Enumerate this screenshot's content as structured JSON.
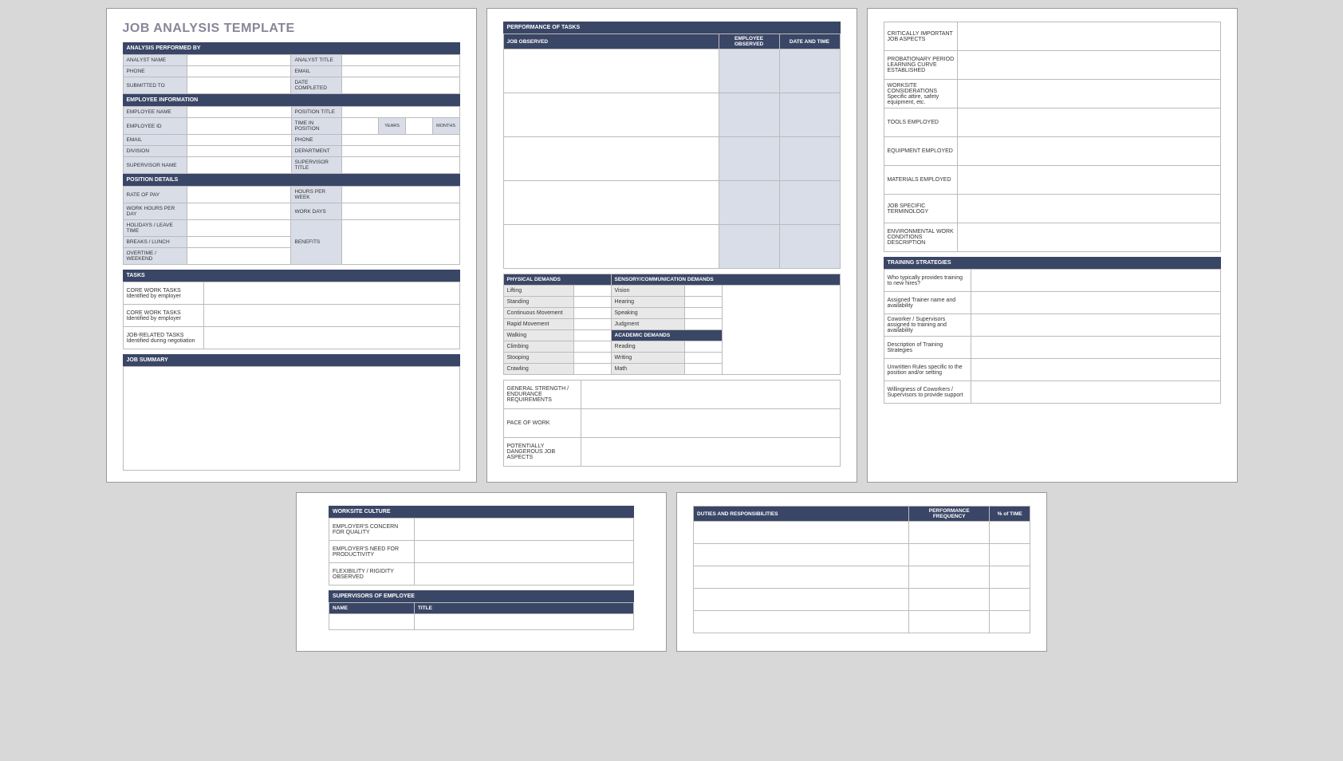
{
  "page1": {
    "title": "JOB ANALYSIS TEMPLATE",
    "sec1": {
      "hdr": "ANALYSIS PERFORMED BY",
      "r1a": "ANALYST NAME",
      "r1b": "ANALYST TITLE",
      "r2a": "PHONE",
      "r2b": "EMAIL",
      "r3a": "SUBMITTED TO",
      "r3b": "DATE COMPLETED"
    },
    "sec2": {
      "hdr": "EMPLOYEE INFORMATION",
      "r1a": "EMPLOYEE NAME",
      "r1b": "POSITION TITLE",
      "r2a": "EMPLOYEE ID",
      "r2b": "TIME IN POSITION",
      "r2c": "YEARS",
      "r2d": "MONTHS",
      "r3a": "EMAIL",
      "r3b": "PHONE",
      "r4a": "DIVISION",
      "r4b": "DEPARTMENT",
      "r5a": "SUPERVISOR NAME",
      "r5b": "SUPERVISOR TITLE"
    },
    "sec3": {
      "hdr": "POSITION DETAILS",
      "r1a": "RATE OF PAY",
      "r1b": "HOURS PER WEEK",
      "r2a": "WORK HOURS PER DAY",
      "r2b": "WORK DAYS",
      "r3a": "HOLIDAYS / LEAVE TIME",
      "r4a": "BREAKS / LUNCH",
      "rb": "BENEFITS",
      "r5a": "OVERTIME / WEEKEND"
    },
    "sec4": {
      "hdr": "TASKS",
      "r1": "CORE WORK TASKS\nIdentified by employer",
      "r2": "CORE WORK TASKS\nIdentified by employer",
      "r3": "JOB-RELATED TASKS\nIdentified during negotiation"
    },
    "sec5": {
      "hdr": "JOB SUMMARY"
    }
  },
  "page2": {
    "sec1": {
      "hdr": "PERFORMANCE OF TASKS",
      "c1": "JOB OBSERVED",
      "c2": "EMPLOYEE OBSERVED",
      "c3": "DATE AND TIME"
    },
    "sec2": {
      "h1": "PHYSICAL DEMANDS",
      "h2": "SENSORY/COMMUNICATION DEMANDS",
      "p1": "Lifting",
      "p2": "Standing",
      "p3": "Continuous Movement",
      "p4": "Rapid Movement",
      "p5": "Walking",
      "p6": "Climbing",
      "p7": "Stooping",
      "p8": "Crawling",
      "s1": "Vision",
      "s2": "Hearing",
      "s3": "Speaking",
      "s4": "Judgment",
      "ah": "ACADEMIC DEMANDS",
      "a1": "Reading",
      "a2": "Writing",
      "a3": "Math"
    },
    "sec3": {
      "r1": "GENERAL STRENGTH / ENDURANCE REQUIREMENTS",
      "r2": "PACE OF WORK",
      "r3": "POTENTIALLY DANGEROUS JOB ASPECTS"
    }
  },
  "page3": {
    "rows": {
      "r1": "CRITICALLY IMPORTANT JOB ASPECTS",
      "r2": "PROBATIONARY PERIOD LEARNING CURVE ESTABLISHED",
      "r3": "WORKSITE CONSIDERATIONS\nSpecific attire, safety equipment, etc.",
      "r4": "TOOLS EMPLOYED",
      "r5": "EQUIPMENT EMPLOYED",
      "r6": "MATERIALS EMPLOYED",
      "r7": "JOB SPECIFIC TERMINOLOGY",
      "r8": "ENVIRONMENTAL WORK CONDITIONS DESCRIPTION"
    },
    "sec2": {
      "hdr": "TRAINING STRATEGIES",
      "r1": "Who typically provides training to new hires?",
      "r2": "Assigned Trainer name and availability",
      "r3": "Coworker / Supervisors assigned to training and availability",
      "r4": "Description of Training Strategies",
      "r5": "Unwritten Rules specific to the position and/or setting",
      "r6": "Willingness of Coworkers / Supervisors to provide support"
    }
  },
  "page4": {
    "sec1": {
      "hdr": "WORKSITE CULTURE",
      "r1": "EMPLOYER'S CONCERN FOR QUALITY",
      "r2": "EMPLOYER'S NEED FOR PRODUCTIVITY",
      "r3": "FLEXIBILITY / RIGIDITY OBSERVED"
    },
    "sec2": {
      "hdr": "SUPERVISORS OF EMPLOYEE",
      "c1": "NAME",
      "c2": "TITLE"
    }
  },
  "page5": {
    "sec1": {
      "hdr": "DUTIES AND RESPONSIBILITIES",
      "c1": "PERFORMANCE FREQUENCY",
      "c2": "% of TIME"
    }
  }
}
